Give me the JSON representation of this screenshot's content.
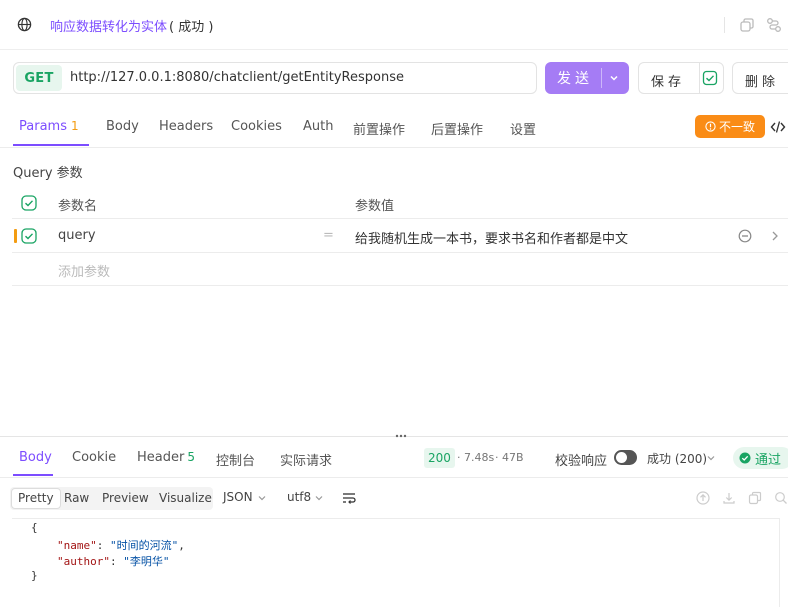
{
  "title_bar": {
    "request_name": "响应数据转化为实体",
    "status": "( 成功 )"
  },
  "request": {
    "method": "GET",
    "url": "http://127.0.0.1:8080/chatclient/getEntityResponse",
    "send_label": "发送",
    "save_label": "保存",
    "delete_label": "删除"
  },
  "request_tabs": [
    {
      "label": "Params",
      "count": "1"
    },
    {
      "label": "Body"
    },
    {
      "label": "Headers"
    },
    {
      "label": "Cookies"
    },
    {
      "label": "Auth"
    },
    {
      "label": "前置操作"
    },
    {
      "label": "后置操作"
    },
    {
      "label": "设置"
    }
  ],
  "mismatch_label": "不一致",
  "query": {
    "title": "Query 参数",
    "col_name": "参数名",
    "col_value": "参数值",
    "rows": [
      {
        "name": "query",
        "eq": "=",
        "value": "给我随机生成一本书，要求书名和作者都是中文"
      }
    ],
    "add_placeholder": "添加参数"
  },
  "response_tabs": [
    {
      "label": "Body"
    },
    {
      "label": "Cookie"
    },
    {
      "label": "Header",
      "count": "5"
    },
    {
      "label": "控制台"
    },
    {
      "label": "实际请求"
    }
  ],
  "response_meta": {
    "status_code": "200",
    "time": "7.48s",
    "size": "47B",
    "verify_label": "校验响应",
    "status_select": "成功 (200)",
    "pass_label": "通过"
  },
  "format": {
    "options": [
      "Pretty",
      "Raw",
      "Preview",
      "Visualize"
    ],
    "type": "JSON",
    "encoding": "utf8"
  },
  "response_body": {
    "open_brace": "{",
    "name_key": "\"name\"",
    "name_value": "\"时间的河流\"",
    "author_key": "\"author\"",
    "author_value": "\"李明华\"",
    "close_brace": "}"
  },
  "colors": {
    "accent": "#7c4dff",
    "send": "#a57cf5",
    "success": "#19a463",
    "warning": "#fa8c16"
  }
}
